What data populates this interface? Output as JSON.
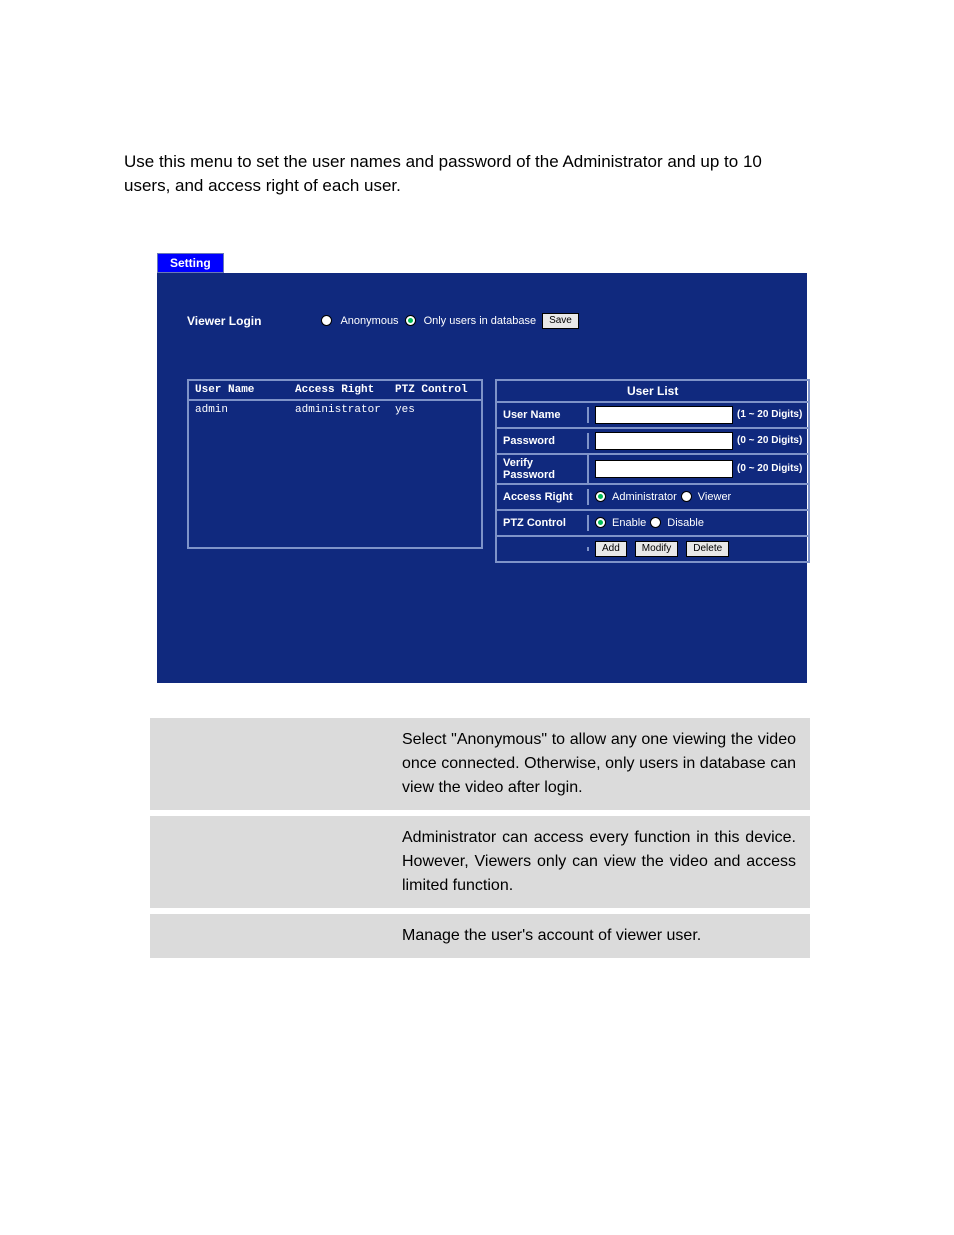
{
  "intro": "Use this menu to set the user names and password of the Administrator and up to 10 users, and access right of each user.",
  "tab": "Setting",
  "viewer_login": {
    "label": "Viewer Login",
    "radios": {
      "anonymous": "Anonymous",
      "only_db": "Only users in database"
    },
    "save": "Save"
  },
  "left": {
    "headers": {
      "user": "User Name",
      "access": "Access Right",
      "ptz": "PTZ Control"
    },
    "rows": [
      {
        "user": "admin",
        "access": "administrator",
        "ptz": "yes"
      }
    ]
  },
  "right": {
    "title": "User List",
    "rows": {
      "username": {
        "label": "User Name",
        "hint": "(1 ~ 20 Digits)"
      },
      "password": {
        "label": "Password",
        "hint": "(0 ~ 20 Digits)"
      },
      "verify": {
        "label": "Verify Password",
        "hint": "(0 ~ 20 Digits)"
      },
      "access": {
        "label": "Access Right",
        "opt_admin": "Administrator",
        "opt_viewer": "Viewer"
      },
      "ptz": {
        "label": "PTZ Control",
        "opt_enable": "Enable",
        "opt_disable": "Disable"
      }
    },
    "buttons": {
      "add": "Add",
      "modify": "Modify",
      "delete": "Delete"
    }
  },
  "descriptions": [
    {
      "label": "",
      "text": "Select \"Anonymous\" to allow any one viewing the video once connected. Otherwise, only users in database can view the video after login."
    },
    {
      "label": "",
      "text": "Administrator can access every function in this device. However, Viewers only can view the video and access limited function."
    },
    {
      "label": "",
      "text": "Manage the user's account of viewer user."
    }
  ]
}
